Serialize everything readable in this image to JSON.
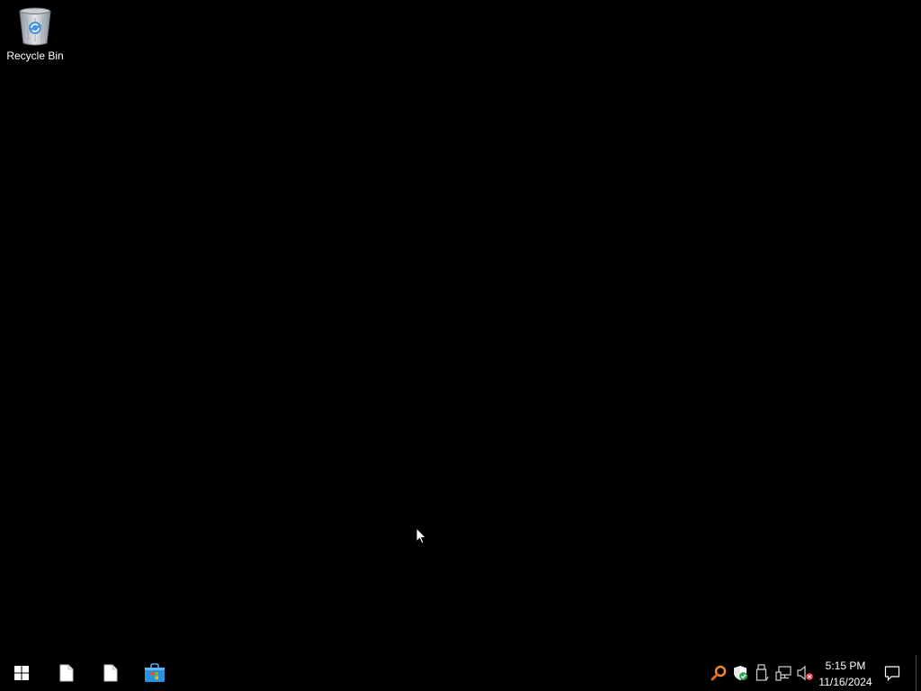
{
  "desktop": {
    "background_color": "#000000",
    "icons": [
      {
        "label": "Recycle Bin",
        "icon": "recycle-bin-icon"
      }
    ]
  },
  "taskbar": {
    "background_color": "#000000",
    "start": {
      "icon": "windows-logo-icon"
    },
    "pinned": [
      {
        "icon": "blank-document-icon"
      },
      {
        "icon": "blank-document-icon"
      },
      {
        "icon": "microsoft-store-icon"
      }
    ],
    "tray": [
      {
        "icon": "search-magnifier-icon",
        "color": "#f0882a"
      },
      {
        "icon": "windows-security-shield-icon",
        "color": "#2fa84f"
      },
      {
        "icon": "usb-device-icon"
      },
      {
        "icon": "network-icon"
      },
      {
        "icon": "volume-muted-icon",
        "color": "#e0343a"
      }
    ],
    "clock": {
      "time": "5:15 PM",
      "date": "11/16/2024"
    },
    "action_center": {
      "icon": "notification-icon"
    }
  }
}
